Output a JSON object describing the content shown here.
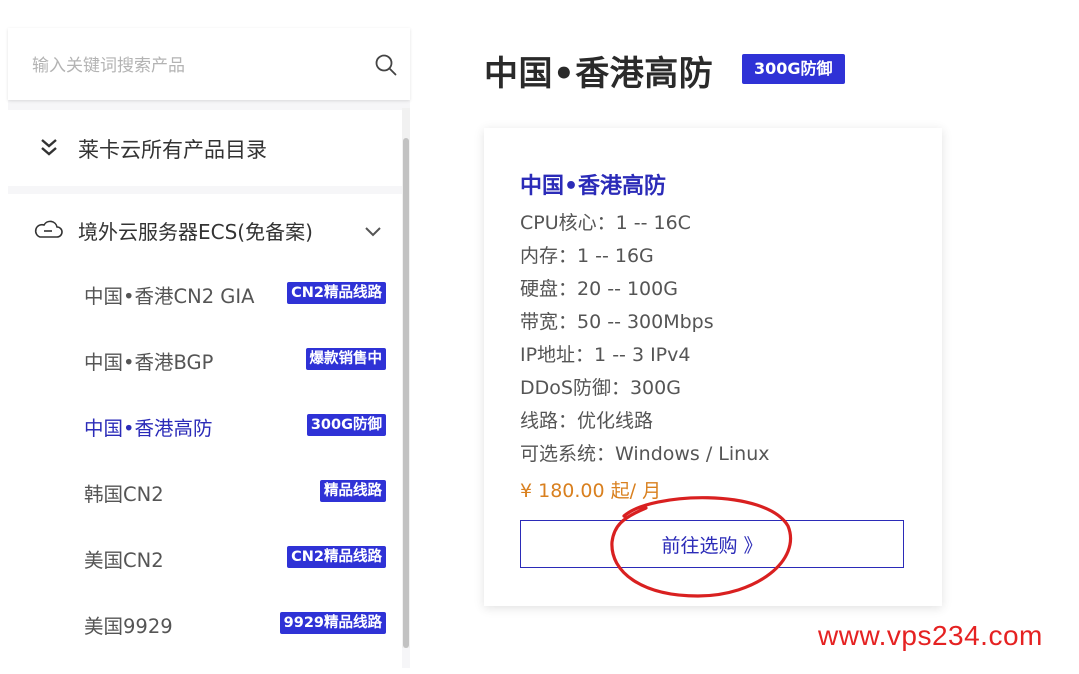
{
  "search": {
    "placeholder": "输入关键词搜索产品",
    "icon": "search-icon"
  },
  "catalog": {
    "label": "莱卡云所有产品目录",
    "icon": "double-chevron-down-icon"
  },
  "sidebar": {
    "section": {
      "label": "境外云服务器ECS(免备案)",
      "icon": "cloud-icon",
      "toggle_icon": "chevron-down-icon"
    },
    "items": [
      {
        "label": "中国•香港CN2 GIA",
        "badge": "CN2精品线路",
        "active": false
      },
      {
        "label": "中国•香港BGP",
        "badge": "爆款销售中",
        "active": false
      },
      {
        "label": "中国•香港高防",
        "badge": "300G防御",
        "active": true
      },
      {
        "label": "韩国CN2",
        "badge": "精品线路",
        "active": false
      },
      {
        "label": "美国CN2",
        "badge": "CN2精品线路",
        "active": false
      },
      {
        "label": "美国9929",
        "badge": "9929精品线路",
        "active": false
      }
    ]
  },
  "main": {
    "title": "中国•香港高防",
    "badge": "300G防御",
    "card": {
      "title": "中国•香港高防",
      "specs": [
        "CPU核心：1 -- 16C",
        "内存：1 -- 16G",
        "硬盘：20 -- 100G",
        "带宽：50 -- 300Mbps",
        "IP地址：1 -- 3 IPv4",
        "DDoS防御：300G",
        "线路：优化线路",
        "可选系统：Windows / Linux"
      ],
      "price": "¥ 180.00 起/ 月",
      "buy_label": "前往选购 》"
    }
  },
  "watermark": "www.vps234.com",
  "colors": {
    "accent": "#2b2bb8",
    "badge_bg": "#2f32d6",
    "price": "#d9801f",
    "annotation": "#d92020"
  }
}
